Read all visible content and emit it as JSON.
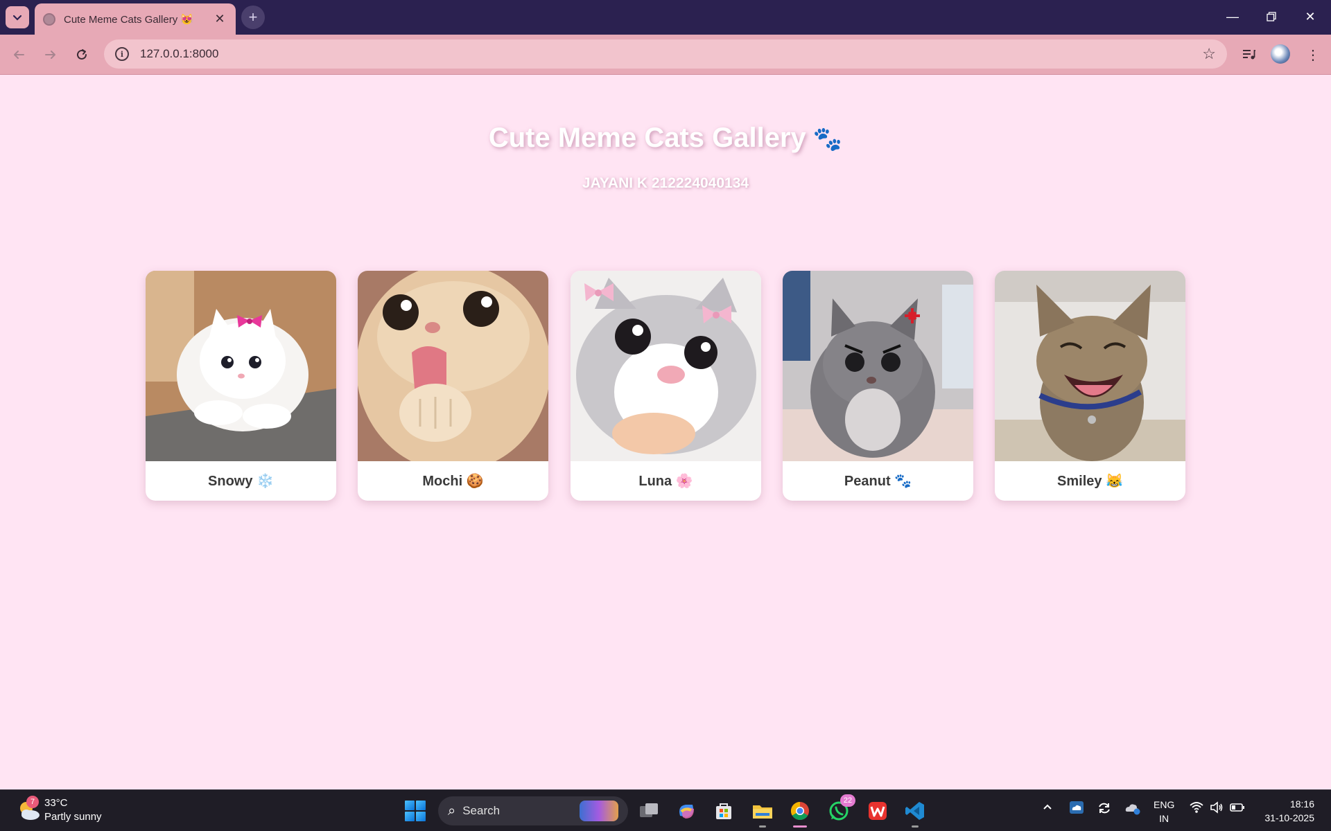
{
  "browser": {
    "tab_title": "Cute Meme Cats Gallery 😻",
    "url": "127.0.0.1:8000"
  },
  "page": {
    "title": "Cute Meme Cats Gallery",
    "title_icon": "🐾",
    "subtitle": "JAYANI K 212224040134"
  },
  "cats": [
    {
      "name": "Snowy ❄️"
    },
    {
      "name": "Mochi 🍪"
    },
    {
      "name": "Luna 🌸"
    },
    {
      "name": "Peanut 🐾"
    },
    {
      "name": "Smiley 😹"
    }
  ],
  "taskbar": {
    "weather_badge": "7",
    "temperature": "33°C",
    "condition": "Partly sunny",
    "search_label": "Search",
    "whatsapp_badge": "22",
    "lang_line1": "ENG",
    "lang_line2": "IN",
    "time": "18:16",
    "date": "31-10-2025"
  },
  "colors": {
    "page_bg": "#ffe4f3",
    "tab_bg": "#e7a9b6",
    "tabbar_bg": "#2b2150",
    "taskbar_bg": "#1f1d26"
  }
}
